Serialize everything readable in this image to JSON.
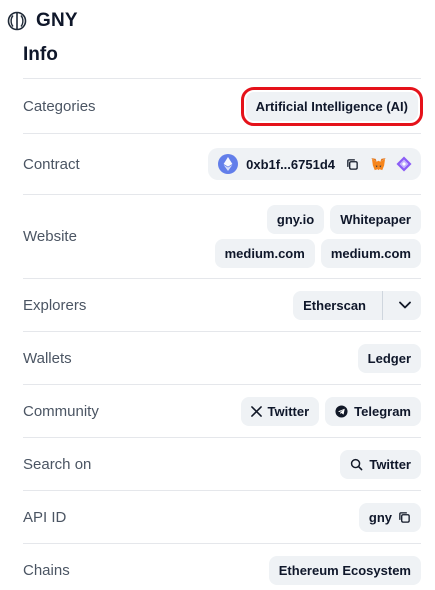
{
  "header": {
    "logo_icon": "gny-logo-icon",
    "coin_name": "GNY"
  },
  "section": {
    "title": "Info"
  },
  "rows": {
    "categories": {
      "label": "Categories",
      "chips": [
        "Artificial Intelligence (AI)"
      ]
    },
    "contract": {
      "label": "Contract",
      "address": "0xb1f...6751d4",
      "chain_icon": "ethereum-icon",
      "actions": [
        "copy-icon",
        "metamask-icon",
        "web3-wallet-icon"
      ]
    },
    "website": {
      "label": "Website",
      "chips": [
        "gny.io",
        "Whitepaper",
        "medium.com",
        "medium.com"
      ]
    },
    "explorers": {
      "label": "Explorers",
      "primary": "Etherscan",
      "dropdown_icon": "chevron-down-icon"
    },
    "wallets": {
      "label": "Wallets",
      "chips": [
        "Ledger"
      ]
    },
    "community": {
      "label": "Community",
      "chips": [
        {
          "icon": "x-twitter-icon",
          "text": "Twitter"
        },
        {
          "icon": "telegram-icon",
          "text": "Telegram"
        }
      ]
    },
    "search_on": {
      "label": "Search on",
      "chips": [
        {
          "icon": "search-icon",
          "text": "Twitter"
        }
      ]
    },
    "api_id": {
      "label": "API ID",
      "value": "gny",
      "action_icon": "copy-icon"
    },
    "chains": {
      "label": "Chains",
      "chips": [
        "Ethereum Ecosystem"
      ]
    }
  },
  "colors": {
    "chip_bg": "#eff2f5",
    "highlight": "#e5121a",
    "label": "#4b5563",
    "text": "#0f172a",
    "ethereum": "#627eea",
    "divider": "#e5e7eb"
  }
}
